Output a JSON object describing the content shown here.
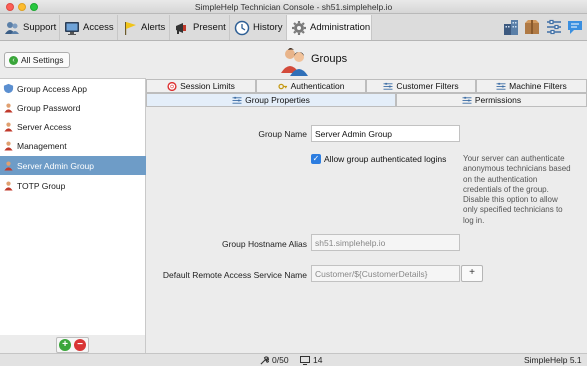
{
  "window": {
    "title": "SimpleHelp Technician Console - sh51.simplehelp.io"
  },
  "toolbar": {
    "tabs": [
      {
        "label": "Support",
        "icon": "support-icon"
      },
      {
        "label": "Access",
        "icon": "monitor-icon"
      },
      {
        "label": "Alerts",
        "icon": "flag-icon"
      },
      {
        "label": "Present",
        "icon": "megaphone-icon"
      },
      {
        "label": "History",
        "icon": "clock-icon"
      },
      {
        "label": "Administration",
        "icon": "gear-icon",
        "active": true
      }
    ],
    "right_icons": [
      "building-icon",
      "package-icon",
      "settings-sliders-icon",
      "chat-icon"
    ]
  },
  "header": {
    "all_settings_label": "All Settings",
    "page_title": "Groups"
  },
  "sidebar": {
    "items": [
      {
        "label": "Group Access App",
        "icon": "shield-icon"
      },
      {
        "label": "Group Password",
        "icon": "user-icon"
      },
      {
        "label": "Server Access",
        "icon": "user-icon"
      },
      {
        "label": "Management",
        "icon": "user-icon"
      },
      {
        "label": "Server Admin Group",
        "icon": "user-icon",
        "selected": true
      },
      {
        "label": "TOTP Group",
        "icon": "user-icon"
      }
    ]
  },
  "tabs": {
    "row1": [
      "Session Limits",
      "Authentication",
      "Customer Filters",
      "Machine Filters"
    ],
    "row2": [
      "Group Properties",
      "Permissions"
    ],
    "active": "Group Properties"
  },
  "form": {
    "group_name_label": "Group Name",
    "group_name_value": "Server Admin Group",
    "allow_auth_label": "Allow group authenticated logins",
    "allow_auth_checked": true,
    "help_text_lines": [
      "Your server can authenticate",
      "anonymous technicians based",
      "on the authentication",
      "credentials of the group.",
      "Disable this option to allow",
      "only specified technicians to",
      "log in."
    ],
    "hostname_alias_label": "Group Hostname Alias",
    "hostname_alias_value": "sh51.simplehelp.io",
    "remote_service_label": "Default Remote Access Service Name",
    "remote_service_value": "Customer/${CustomerDetails}",
    "plus_label": "+"
  },
  "status": {
    "connections": "0/50",
    "machines": "14",
    "version": "SimpleHelp  5.1"
  },
  "colors": {
    "selected_row": "#6e9cc7",
    "active_tab": "#e4eef9",
    "checkbox": "#2c7de0"
  }
}
